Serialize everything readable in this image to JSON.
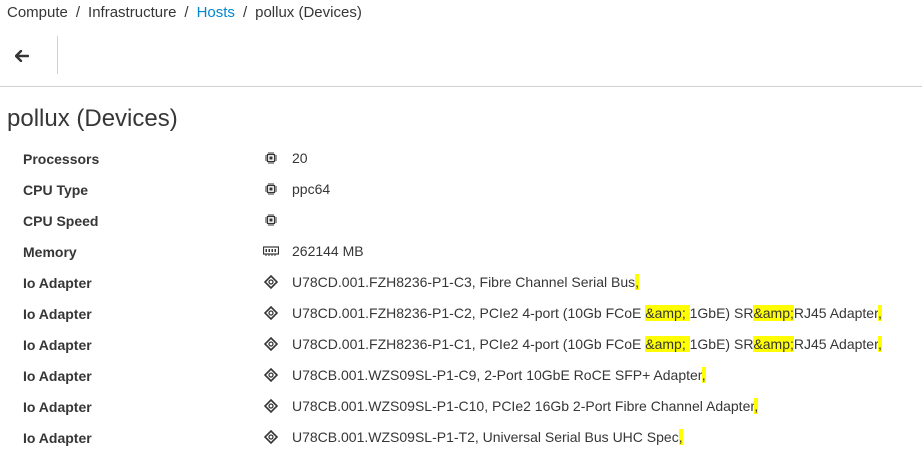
{
  "breadcrumb": {
    "items": [
      "Compute",
      "Infrastructure",
      "Hosts",
      "pollux (Devices)"
    ],
    "separator": "/"
  },
  "toolbar": {
    "back_icon": "arrow-left-icon"
  },
  "page": {
    "title": "pollux (Devices)"
  },
  "colors": {
    "link": "#0088ce",
    "highlight": "#ffff00",
    "text": "#363636",
    "border": "#d1d1d1"
  },
  "properties": [
    {
      "label": "Processors",
      "icon": "cpu-chip-icon",
      "value": "20"
    },
    {
      "label": "CPU Type",
      "icon": "cpu-chip-icon",
      "value": "ppc64"
    },
    {
      "label": "CPU Speed",
      "icon": "cpu-chip-icon",
      "value": ""
    },
    {
      "label": "Memory",
      "icon": "memory-module-icon",
      "value": "262144 MB"
    },
    {
      "label": "Io Adapter",
      "icon": "adapter-icon",
      "value_parts": [
        "U78CD.001.FZH8236-P1-C3, Fibre Channel Serial Bus",
        ","
      ]
    },
    {
      "label": "Io Adapter",
      "icon": "adapter-icon",
      "value_parts": [
        "U78CD.001.FZH8236-P1-C2, PCIe2 4-port (10Gb FCoE ",
        "&amp; ",
        "1GbE) SR",
        "&amp;",
        "RJ45 Adapter",
        ", "
      ]
    },
    {
      "label": "Io Adapter",
      "icon": "adapter-icon",
      "value_parts": [
        "U78CD.001.FZH8236-P1-C1, PCIe2 4-port (10Gb FCoE ",
        "&amp; ",
        "1GbE) SR",
        "&amp;",
        "RJ45 Adapter",
        ",  "
      ]
    },
    {
      "label": "Io Adapter",
      "icon": "adapter-icon",
      "value_parts": [
        "U78CB.001.WZS09SL-P1-C9, 2-Port 10GbE RoCE SFP+ Adapter",
        ","
      ]
    },
    {
      "label": "Io Adapter",
      "icon": "adapter-icon",
      "value_parts": [
        "U78CB.001.WZS09SL-P1-C10, PCIe2 16Gb 2-Port Fibre Channel Adapter",
        ","
      ]
    },
    {
      "label": "Io Adapter",
      "icon": "adapter-icon",
      "value_parts": [
        "U78CB.001.WZS09SL-P1-T2, Universal Serial Bus UHC Spec",
        ","
      ]
    }
  ]
}
